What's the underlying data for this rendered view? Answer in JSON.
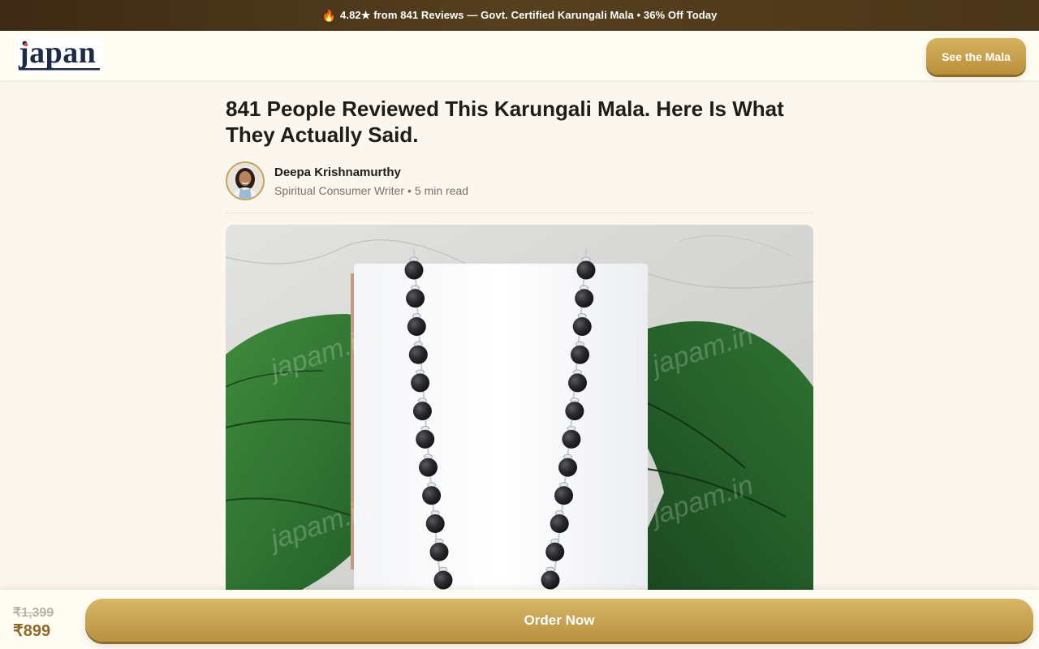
{
  "announcement": {
    "icon": "fire-icon",
    "text": "4.82★ from 841 Reviews — Govt. Certified Karungali Mala • 36% Off Today"
  },
  "header": {
    "logo_text": "japan",
    "cta_label": "See the Mala"
  },
  "article": {
    "headline": "841 People Reviewed This Karungali Mala. Here Is What They Actually Said.",
    "author": {
      "name": "Deepa Krishnamurthy",
      "role": "Spiritual Consumer Writer",
      "separator": "•",
      "read_time": "5 min read"
    },
    "hero_image": {
      "watermark": "japam.in"
    }
  },
  "purchase_bar": {
    "old_price": "₹1,399",
    "new_price": "₹899",
    "order_label": "Order Now"
  },
  "colors": {
    "accent_gold": "#c9a24c",
    "announcement_bg": "#3d2a14",
    "page_bg": "#fbf6ee"
  }
}
